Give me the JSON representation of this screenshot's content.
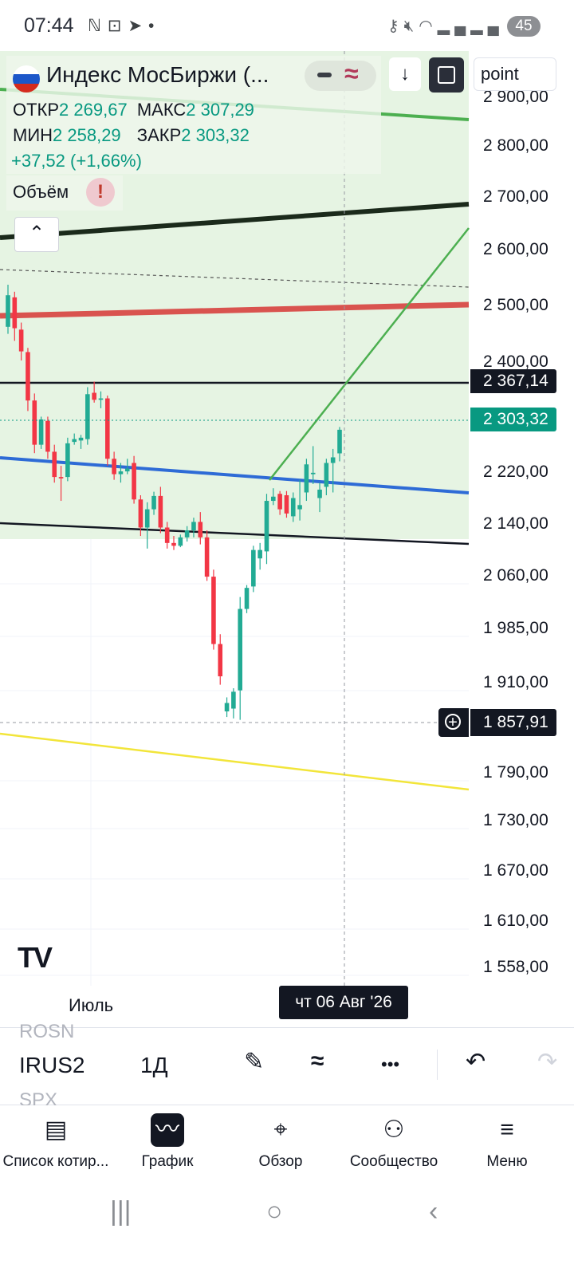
{
  "status_bar": {
    "time": "07:44",
    "left_icons": [
      "notification-n-icon",
      "screenshot-icon",
      "telegram-icon",
      "dot-icon"
    ],
    "right_icons": [
      "vpn-key-icon",
      "mute-icon",
      "wifi-icon",
      "signal-icon",
      "signal-icon"
    ],
    "battery": "45"
  },
  "legend": {
    "title": "Индекс МосБиржи (...",
    "open_label": "ОТКР",
    "open_value": "2 269,67",
    "high_label": "МАКС",
    "high_value": "2 307,29",
    "low_label": "МИН",
    "low_value": "2 258,29",
    "close_label": "ЗАКР",
    "close_value": "2 303,32",
    "change": "+37,52 (+1,66%)",
    "volume_label": "Объём",
    "volume_alert": "!",
    "collapse_icon": "chevron-up-icon"
  },
  "header_buttons": {
    "download_icon": "↓",
    "fullscreen_icon": "fullscreen-icon",
    "search_value": "point"
  },
  "price_axis": {
    "ticks": [
      "2 900,00",
      "2 800,00",
      "2 700,00",
      "2 600,00",
      "2 500,00",
      "2 400,00",
      "2 220,00",
      "2 140,00",
      "2 060,00",
      "1 985,00",
      "1 910,00",
      "1 790,00",
      "1 730,00",
      "1 670,00",
      "1 610,00",
      "1 558,00"
    ],
    "tag_line": "2 367,14",
    "tag_last": "2 303,32",
    "tag_crosshair": "1 857,91"
  },
  "time_axis": {
    "month_label": "Июль",
    "crosshair_date": "чт 06 Авг '26"
  },
  "colors": {
    "up": "#22ab94",
    "down": "#f23645",
    "accent": "#089981",
    "zone": "#e3f2df"
  },
  "chart_data": {
    "type": "candlestick",
    "symbol": "Индекс МосБиржи",
    "interval": "1Д",
    "ylim": [
      1530,
      2935
    ],
    "last": {
      "open": 2269.67,
      "high": 2307.29,
      "low": 2258.29,
      "close": 2303.32,
      "change": 37.52,
      "change_pct": 1.66
    },
    "candles": [
      [
        2450,
        2510,
        2440,
        2495
      ],
      [
        2492,
        2500,
        2430,
        2448
      ],
      [
        2446,
        2456,
        2402,
        2415
      ],
      [
        2414,
        2420,
        2330,
        2345
      ],
      [
        2345,
        2355,
        2270,
        2282
      ],
      [
        2282,
        2322,
        2276,
        2318
      ],
      [
        2316,
        2322,
        2262,
        2272
      ],
      [
        2272,
        2282,
        2228,
        2236
      ],
      [
        2236,
        2252,
        2202,
        2234
      ],
      [
        2236,
        2292,
        2230,
        2284
      ],
      [
        2286,
        2298,
        2282,
        2290
      ],
      [
        2288,
        2296,
        2276,
        2292
      ],
      [
        2290,
        2364,
        2282,
        2354
      ],
      [
        2356,
        2372,
        2342,
        2346
      ],
      [
        2346,
        2358,
        2334,
        2348
      ],
      [
        2348,
        2352,
        2252,
        2262
      ],
      [
        2262,
        2272,
        2232,
        2240
      ],
      [
        2240,
        2256,
        2228,
        2244
      ],
      [
        2244,
        2262,
        2240,
        2248
      ],
      [
        2256,
        2266,
        2198,
        2204
      ],
      [
        2204,
        2210,
        2152,
        2164
      ],
      [
        2164,
        2200,
        2134,
        2190
      ],
      [
        2190,
        2215,
        2182,
        2209
      ],
      [
        2209,
        2222,
        2156,
        2164
      ],
      [
        2164,
        2172,
        2134,
        2142
      ],
      [
        2142,
        2152,
        2132,
        2138
      ],
      [
        2138,
        2154,
        2136,
        2150
      ],
      [
        2150,
        2166,
        2144,
        2160
      ],
      [
        2160,
        2178,
        2150,
        2172
      ],
      [
        2172,
        2186,
        2140,
        2150
      ],
      [
        2150,
        2160,
        2088,
        2094
      ],
      [
        2094,
        2104,
        1990,
        1998
      ],
      [
        1998,
        2012,
        1940,
        1952
      ],
      [
        1902,
        1922,
        1894,
        1914
      ],
      [
        1906,
        1935,
        1892,
        1930
      ],
      [
        1932,
        2065,
        1890,
        2048
      ],
      [
        2048,
        2082,
        2042,
        2078
      ],
      [
        2080,
        2138,
        2072,
        2132
      ],
      [
        2120,
        2142,
        2104,
        2132
      ],
      [
        2130,
        2212,
        2112,
        2202
      ],
      [
        2202,
        2220,
        2196,
        2208
      ],
      [
        2212,
        2216,
        2182,
        2190
      ],
      [
        2210,
        2216,
        2178,
        2184
      ],
      [
        2180,
        2214,
        2172,
        2206
      ],
      [
        2190,
        2232,
        2174,
        2196
      ],
      [
        2214,
        2262,
        2202,
        2254
      ],
      [
        2240,
        2280,
        2226,
        2242
      ],
      [
        2206,
        2228,
        2186,
        2218
      ],
      [
        2222,
        2262,
        2210,
        2256
      ],
      [
        2256,
        2276,
        2214,
        2264
      ],
      [
        2269.67,
        2307.29,
        2258.29,
        2303.32
      ]
    ]
  },
  "toolbar": {
    "symbol_prev": "ROSN",
    "symbol": "IRUS2",
    "symbol_next": "SPX",
    "interval": "1Д",
    "draw_icon": "✎",
    "indicators_icon": "≈",
    "more_icon": "•••",
    "undo_icon": "↶",
    "redo_icon": "↷"
  },
  "bottom_nav": {
    "items": [
      {
        "label": "Список котир...",
        "icon": "▤"
      },
      {
        "label": "График",
        "icon": "〰"
      },
      {
        "label": "Обзор",
        "icon": "⌖"
      },
      {
        "label": "Сообщество",
        "icon": "⚇"
      },
      {
        "label": "Меню",
        "icon": "≡"
      }
    ]
  },
  "system_nav": {
    "recent": "|||",
    "home": "○",
    "back": "‹"
  }
}
